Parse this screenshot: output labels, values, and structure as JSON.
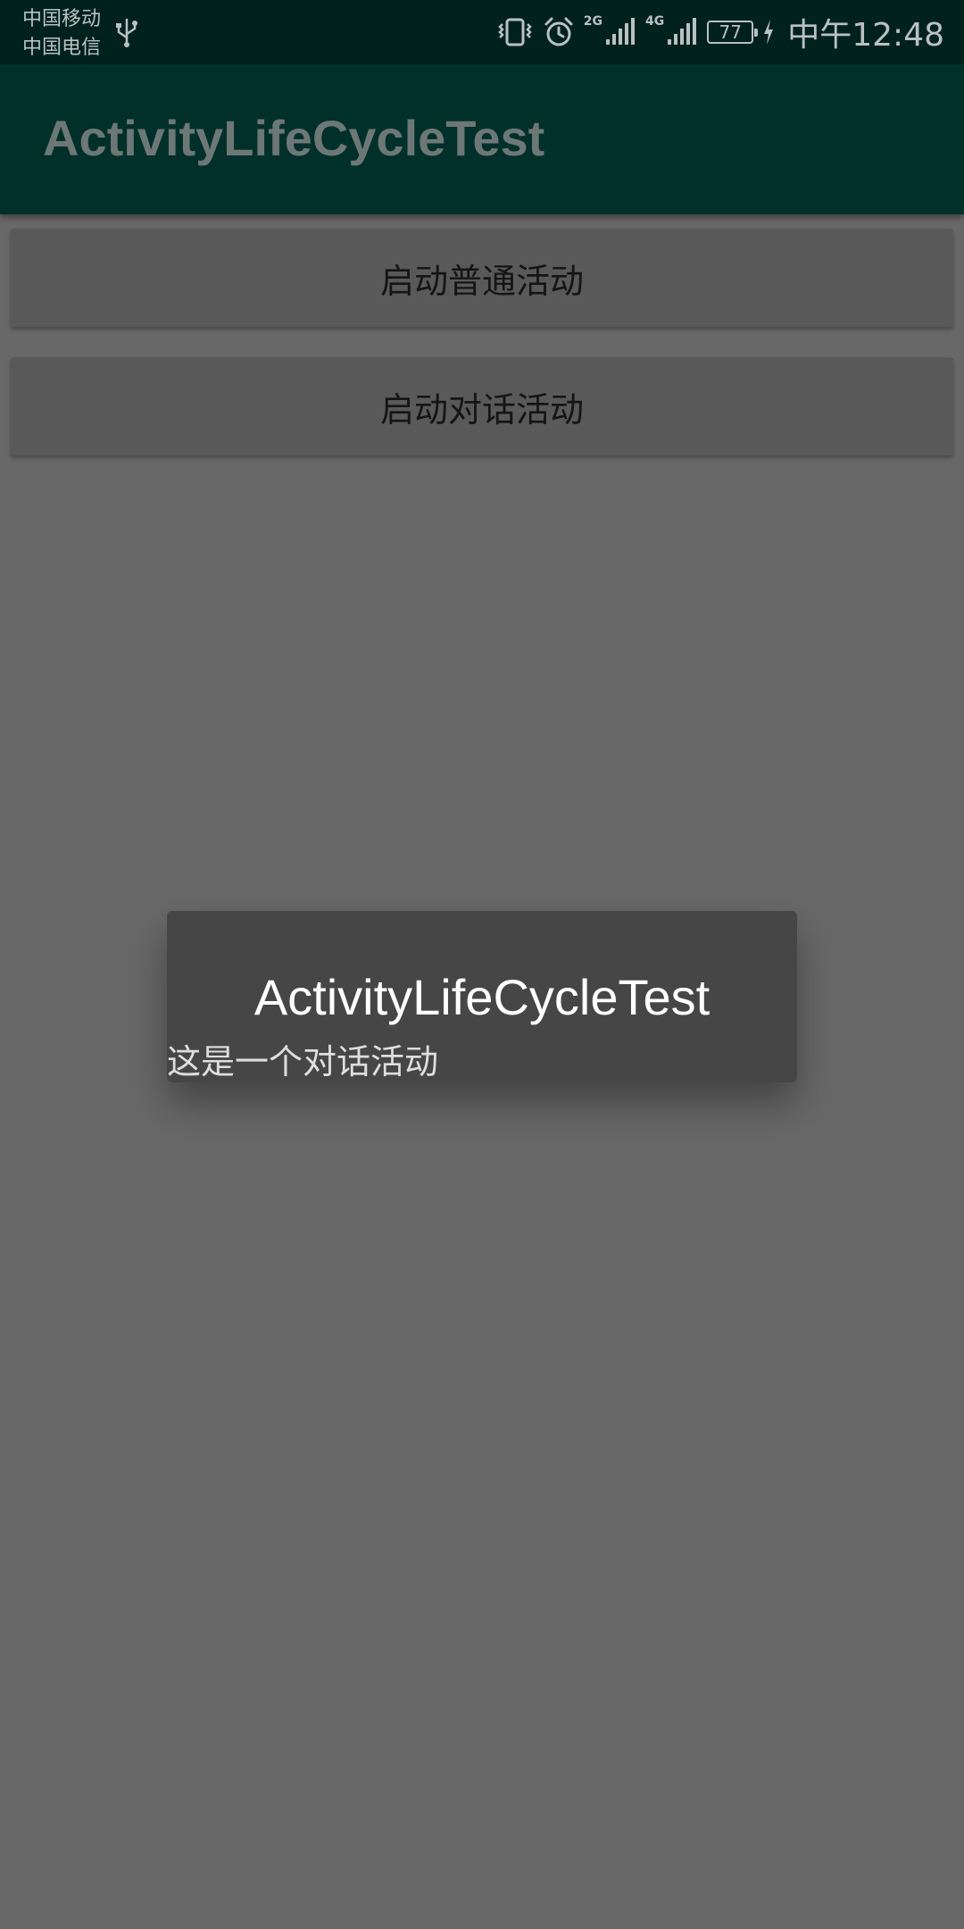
{
  "status_bar": {
    "carrier_1": "中国移动",
    "carrier_2": "中国电信",
    "network_1": "2G",
    "network_2": "4G",
    "battery_level": "77",
    "time": "中午12:48",
    "icons": [
      "usb-icon",
      "vibrate-icon",
      "alarm-icon",
      "signal-icon",
      "signal-icon",
      "battery-icon",
      "charging-icon"
    ]
  },
  "app_bar": {
    "title": "ActivityLifeCycleTest"
  },
  "buttons": {
    "start_normal": "启动普通活动",
    "start_dialog": "启动对话活动"
  },
  "dialog": {
    "title": "ActivityLifeCycleTest",
    "message": "这是一个对话活动"
  },
  "colors": {
    "status_bar_bg": "#01211d",
    "app_bar_bg": "#01302a",
    "scrim_bg": "#686868",
    "button_bg": "#595959",
    "dialog_bg": "#464646"
  }
}
